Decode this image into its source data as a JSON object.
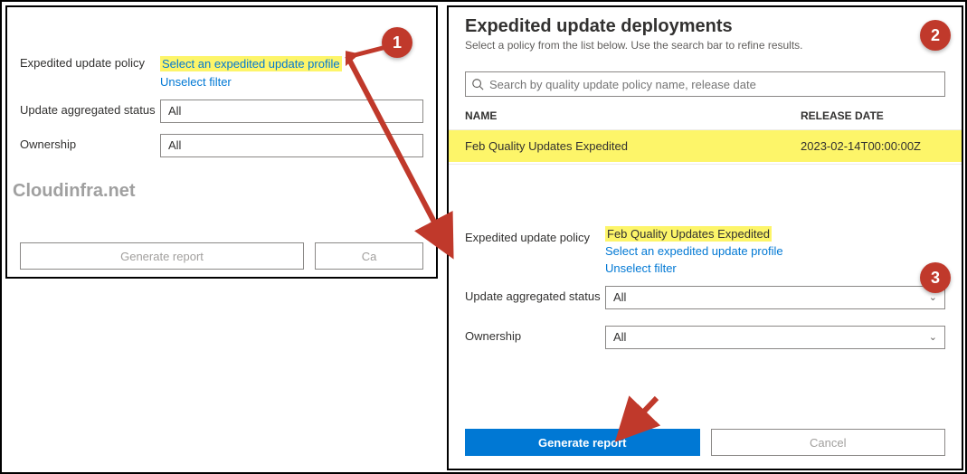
{
  "left": {
    "policy_label": "Expedited update policy",
    "policy_link": "Select an expedited update profile",
    "unselect_link": "Unselect filter",
    "agg_label": "Update aggregated status",
    "agg_value": "All",
    "own_label": "Ownership",
    "own_value": "All",
    "watermark": "Cloudinfra.net",
    "generate_btn": "Generate report",
    "cancel_btn": "Ca"
  },
  "right": {
    "title": "Expedited update deployments",
    "subtitle": "Select a policy from the list below. Use the search bar to refine results.",
    "search_placeholder": "Search by quality update policy name, release date",
    "col_name": "NAME",
    "col_date": "RELEASE DATE",
    "row_name": "Feb Quality Updates Expedited",
    "row_date": "2023-02-14T00:00:00Z",
    "policy_label": "Expedited update policy",
    "policy_selected": "Feb Quality Updates Expedited",
    "select_link": "Select an expedited update profile",
    "unselect_link": "Unselect filter",
    "agg_label": "Update aggregated status",
    "agg_value": "All",
    "own_label": "Ownership",
    "own_value": "All",
    "generate_btn": "Generate report",
    "cancel_btn": "Cancel"
  },
  "badges": {
    "b1": "1",
    "b2": "2",
    "b3": "3"
  }
}
